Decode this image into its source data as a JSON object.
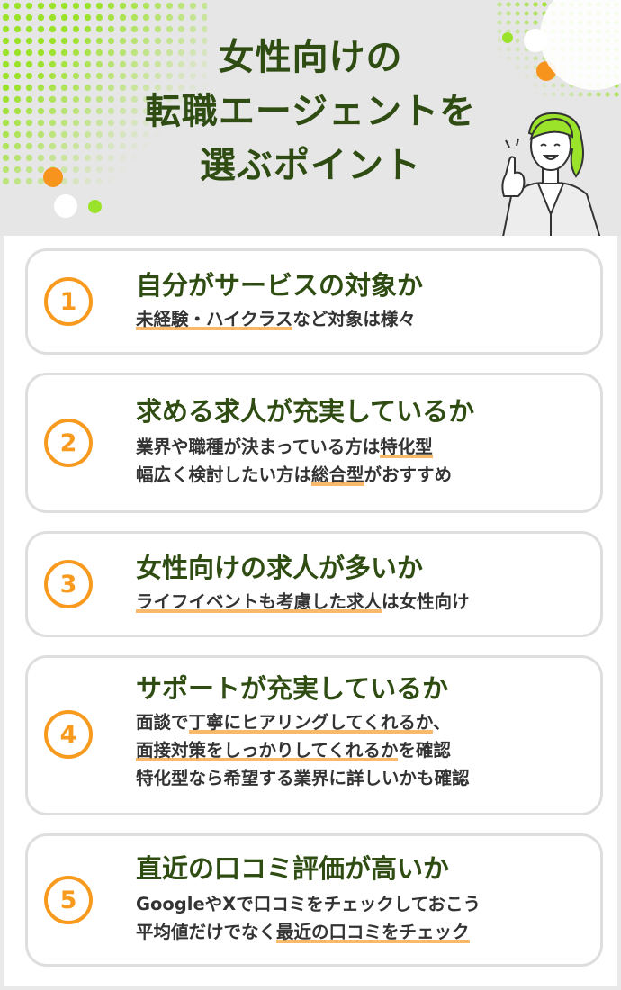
{
  "header": {
    "title_lines": [
      "女性向けの",
      "転職エージェントを",
      "選ぶポイント"
    ],
    "colors": {
      "accent_green": "#9be22a",
      "accent_orange": "#f79a1e",
      "title": "#2f4d12"
    },
    "illustration": "woman-pointing-icon"
  },
  "points": [
    {
      "number": "1",
      "title": "自分がサービスの対象か",
      "lines": [
        {
          "parts": [
            {
              "text": "未経験・ハイクラス",
              "hl": true
            },
            {
              "text": "など対象は様々",
              "hl": false
            }
          ]
        }
      ]
    },
    {
      "number": "2",
      "title": "求める求人が充実しているか",
      "lines": [
        {
          "parts": [
            {
              "text": "業界や職種が決まっている方は",
              "hl": false
            },
            {
              "text": "特化型",
              "hl": true
            }
          ]
        },
        {
          "parts": [
            {
              "text": "幅広く検討したい方は",
              "hl": false
            },
            {
              "text": "総合型",
              "hl": true
            },
            {
              "text": "がおすすめ",
              "hl": false
            }
          ]
        }
      ]
    },
    {
      "number": "3",
      "title": "女性向けの求人が多いか",
      "lines": [
        {
          "parts": [
            {
              "text": "ライフイベントも考慮した求人",
              "hl": true
            },
            {
              "text": "は女性向け",
              "hl": false
            }
          ]
        }
      ]
    },
    {
      "number": "4",
      "title": "サポートが充実しているか",
      "lines": [
        {
          "parts": [
            {
              "text": "面談で",
              "hl": false
            },
            {
              "text": "丁寧にヒアリングしてくれるか",
              "hl": true
            },
            {
              "text": "、",
              "hl": false
            }
          ]
        },
        {
          "parts": [
            {
              "text": "面接対策をしっかりしてくれるか",
              "hl": true
            },
            {
              "text": "を確認",
              "hl": false
            }
          ]
        },
        {
          "parts": [
            {
              "text": "特化型なら希望する業界に詳しいかも確認",
              "hl": false
            }
          ]
        }
      ]
    },
    {
      "number": "5",
      "title": "直近の口コミ評価が高いか",
      "lines": [
        {
          "parts": [
            {
              "text": "GoogleやXで口コミをチェックしておこう",
              "hl": false
            }
          ]
        },
        {
          "parts": [
            {
              "text": "平均値だけでなく",
              "hl": false
            },
            {
              "text": "最近の口コミをチェック",
              "hl": true
            }
          ]
        }
      ]
    }
  ]
}
